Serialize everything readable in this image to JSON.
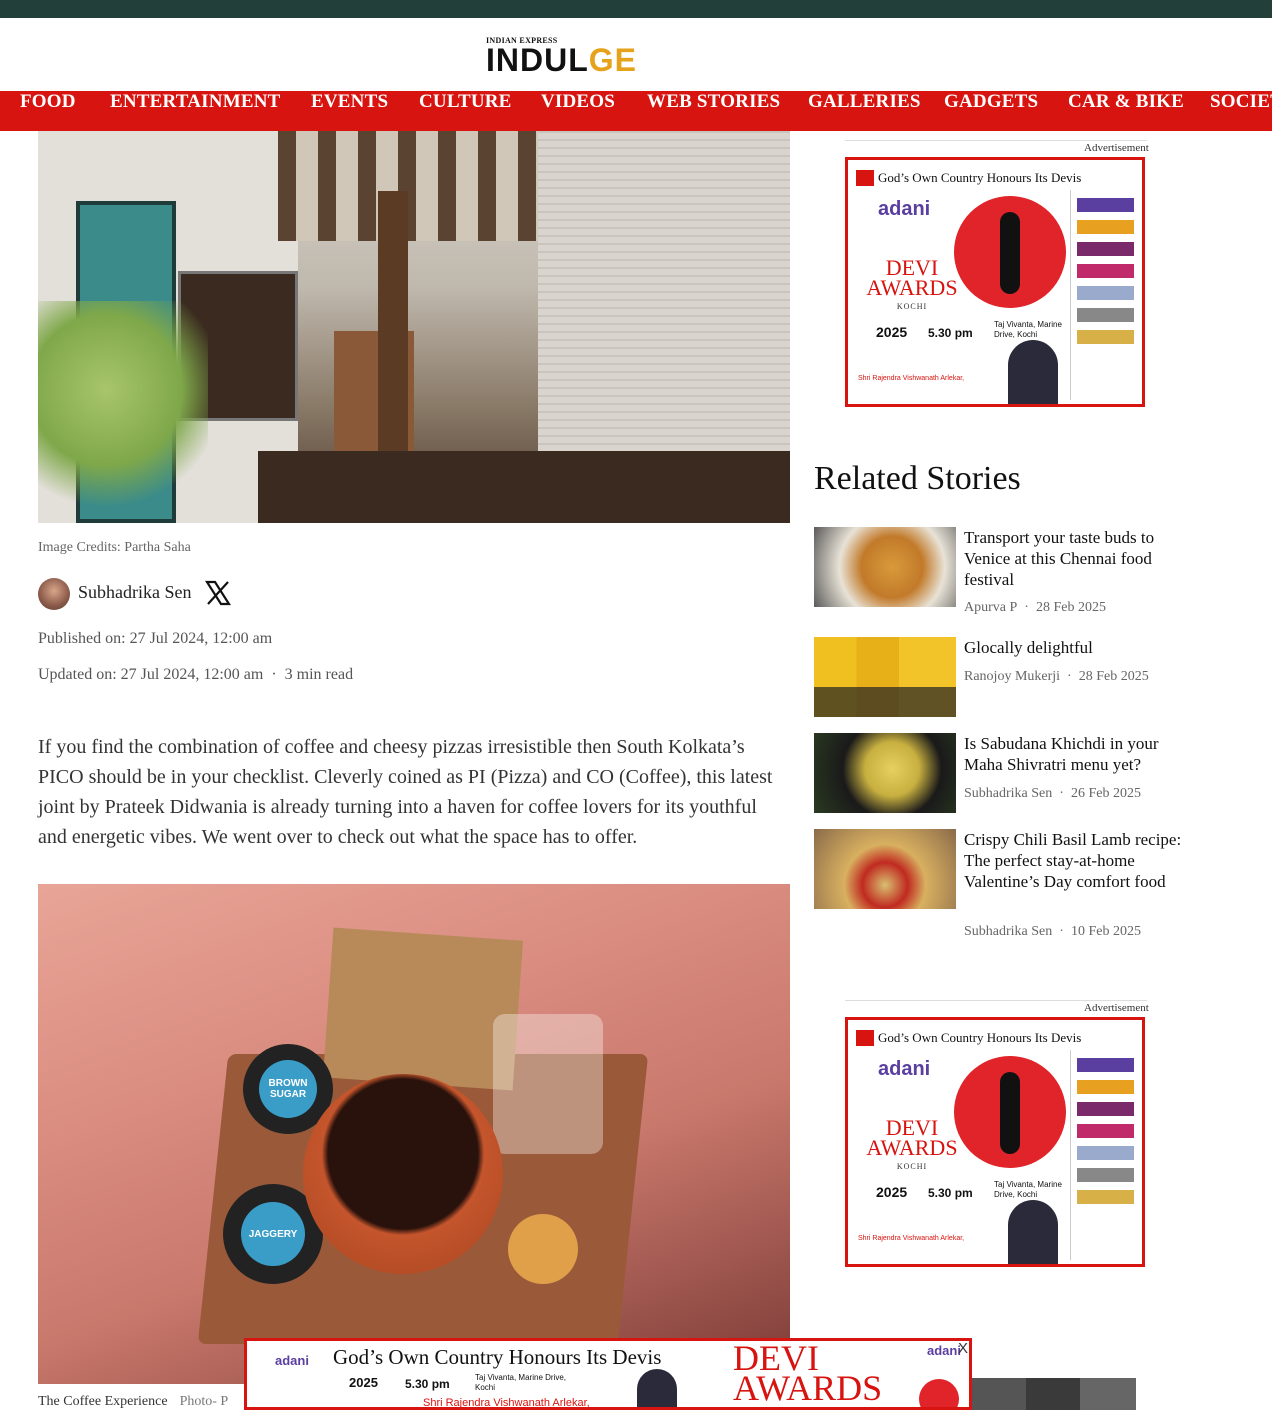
{
  "header": {
    "brand_small": "INDIAN EXPRESS",
    "brand_main_a": "INDUL",
    "brand_main_b": "GE"
  },
  "nav": {
    "items": [
      "FOOD",
      "ENTERTAINMENT",
      "EVENTS",
      "CULTURE",
      "VIDEOS",
      "WEB STORIES",
      "GALLERIES",
      "GADGETS",
      "CAR & BIKE",
      "SOCIETY"
    ]
  },
  "article": {
    "image_caption": "Image Credits: Partha Saha",
    "author": "Subhadrika Sen",
    "published": "Published on: 27 Jul 2024, 12:00 am",
    "updated": "Updated on: 27 Jul 2024, 12:00 am",
    "read_time": "3 min read",
    "lead": "If you find the combination of coffee and cheesy pizzas irresistible then South Kolkata’s PICO should be in your checklist. Cleverly coined as PI (Pizza) and CO (Coffee), this latest joint by Prateek Didwania is already turning into a haven for coffee lovers for its youthful and energetic vibes. We went over to check out what the space has to offer.",
    "coffee_jar1": "BROWN SUGAR",
    "coffee_jar2": "JAGGERY",
    "second_caption": "The Coffee Experience",
    "second_credit": "Photo- P"
  },
  "sidebar": {
    "ad_label": "Advertisement",
    "related_title": "Related Stories",
    "stories": [
      {
        "title": "Transport your taste buds to Venice at this Chennai food festival",
        "author": "Apurva P",
        "date": "28 Feb 2025"
      },
      {
        "title": "Glocally delightful",
        "author": "Ranojoy Mukerji",
        "date": "28 Feb 2025"
      },
      {
        "title": "Is Sabudana Khichdi in your Maha Shivratri menu yet?",
        "author": "Subhadrika Sen",
        "date": "26 Feb 2025"
      },
      {
        "title": "Crispy Chili Basil Lamb recipe: The perfect stay-at-home Valentine’s Day comfort food",
        "author": "Subhadrika Sen",
        "date": "10 Feb 2025"
      }
    ]
  },
  "ad": {
    "headline": "God’s Own Country Honours Its Devis",
    "adani": "adani",
    "devi": "DEVI AWARDS",
    "kochi": "KOCHI",
    "date": "2025",
    "time": "5.30 pm",
    "venue": "Taj Vivanta, Marine Drive, Kochi",
    "governor": "Shri Rajendra Vishwanath Arlekar,",
    "close": "X"
  },
  "colors": {
    "nav_red": "#d7140f",
    "top_strip": "#223f3a",
    "brand_accent": "#e6a21a"
  }
}
